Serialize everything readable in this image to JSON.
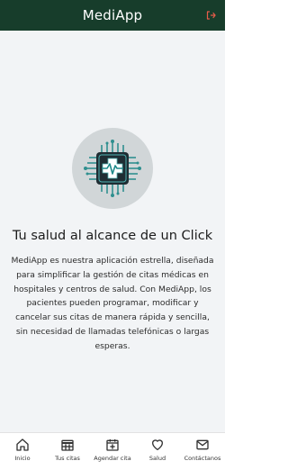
{
  "app_bar": {
    "title": "MediApp",
    "logout_icon": "logout-icon",
    "background": "#173d2b",
    "accent": "#e85c4a"
  },
  "main": {
    "logo_icon": "medical-chip-logo",
    "headline": "Tu salud al alcance de un Click",
    "description": "MediApp es nuestra aplicación estrella, diseñada para simplificar la gestión de citas médicas en hospitales y centros de salud. Con MediApp, los pacientes pueden programar, modificar y cancelar sus citas de manera rápida y sencilla, sin necesidad de llamadas telefónicas o largas esperas."
  },
  "bottom_nav": {
    "items": [
      {
        "label": "Inicio",
        "icon": "home-icon"
      },
      {
        "label": "Tus citas",
        "icon": "calendar-grid-icon"
      },
      {
        "label": "Agendar cita",
        "icon": "calendar-add-icon"
      },
      {
        "label": "Salud",
        "icon": "heart-icon"
      },
      {
        "label": "Contáctanos",
        "icon": "mail-icon"
      }
    ]
  }
}
